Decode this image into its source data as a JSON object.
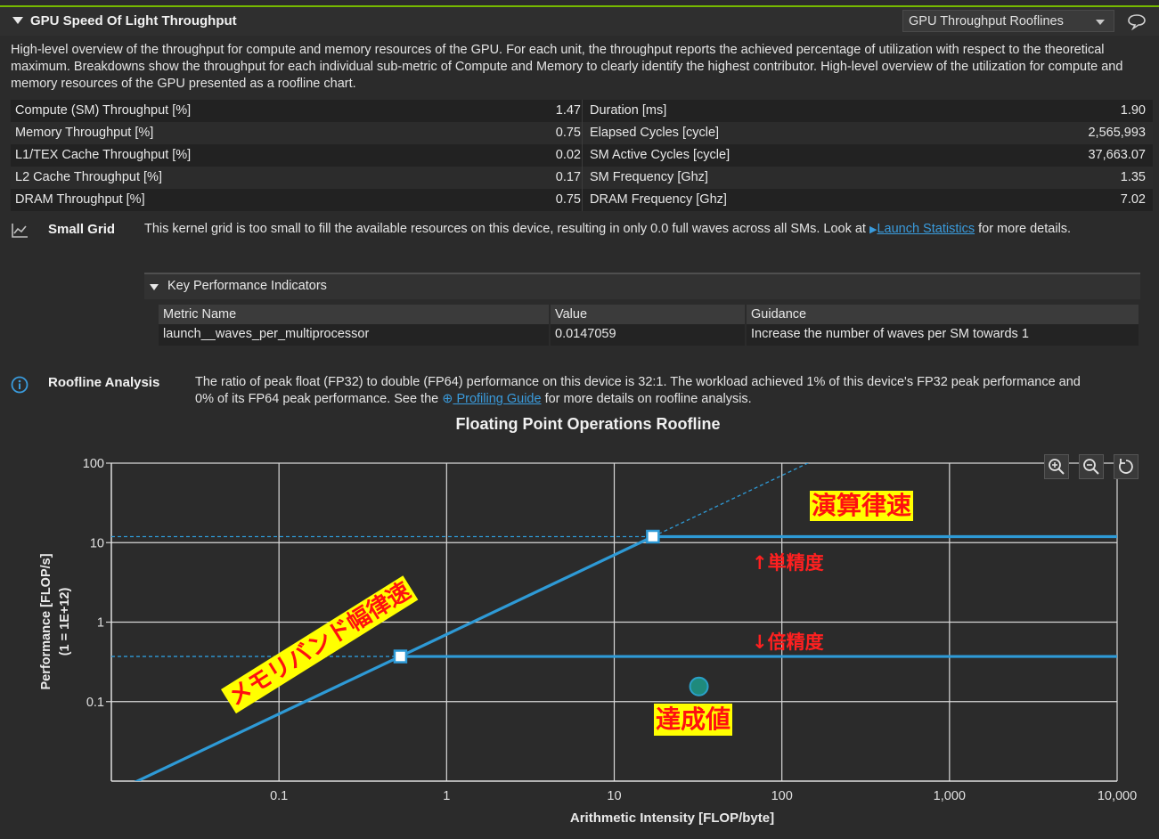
{
  "header": {
    "title": "GPU Speed Of Light Throughput",
    "view_select": "GPU Throughput Rooflines"
  },
  "description": "High-level overview of the throughput for compute and memory resources of the GPU. For each unit, the throughput reports the achieved percentage of utilization with respect to the theoretical maximum. Breakdowns show the throughput for each individual sub-metric of Compute and Memory to clearly identify the highest contributor. High-level overview of the utilization for compute and memory resources of the GPU presented as a roofline chart.",
  "metrics": [
    {
      "left_label": "Compute (SM) Throughput [%]",
      "left_value": "1.47",
      "right_label": "Duration [ms]",
      "right_value": "1.90"
    },
    {
      "left_label": "Memory Throughput [%]",
      "left_value": "0.75",
      "right_label": "Elapsed Cycles [cycle]",
      "right_value": "2,565,993"
    },
    {
      "left_label": "L1/TEX Cache Throughput [%]",
      "left_value": "0.02",
      "right_label": "SM Active Cycles [cycle]",
      "right_value": "37,663.07"
    },
    {
      "left_label": "L2 Cache Throughput [%]",
      "left_value": "0.17",
      "right_label": "SM Frequency [Ghz]",
      "right_value": "1.35"
    },
    {
      "left_label": "DRAM Throughput [%]",
      "left_value": "0.75",
      "right_label": "DRAM Frequency [Ghz]",
      "right_value": "7.02"
    }
  ],
  "small_grid": {
    "title": "Small Grid",
    "text_before": "This kernel grid is too small to fill the available resources on this device, resulting in only 0.0 full waves across all SMs. Look at ",
    "link": "Launch Statistics",
    "text_after": " for more details."
  },
  "kpi": {
    "title": "Key Performance Indicators",
    "headers": [
      "Metric Name",
      "Value",
      "Guidance"
    ],
    "row": [
      "launch__waves_per_multiprocessor",
      "0.0147059",
      "Increase the number of waves per SM towards 1"
    ]
  },
  "roofline": {
    "title": "Roofline Analysis",
    "text_before": "The ratio of peak float (FP32) to double (FP64) performance on this device is 32:1. The workload achieved 1% of this device's FP32 peak performance and 0% of its FP64 peak performance. See the ",
    "link": "Profiling Guide",
    "text_after": " for more details on roofline analysis."
  },
  "annotations": {
    "compute_bound": "演算律速",
    "memory_bound": "メモリバンド幅律速",
    "single_precision": "↑単精度",
    "double_precision": "↓倍精度",
    "achieved": "達成値"
  },
  "colors": {
    "roof": "#2e9ad6",
    "achieved_point": "#1f8a7c",
    "highlight": "#ffff00",
    "annotation_red": "#ff2020",
    "accent_green": "#76b900"
  },
  "chart_data": {
    "type": "line",
    "title": "Floating Point Operations Roofline",
    "xlabel": "Arithmetic Intensity [FLOP/byte]",
    "ylabel": "Performance [FLOP/s]",
    "ylabel2": "(1 = 1E+12)",
    "x_scale": "log",
    "y_scale": "log",
    "xlim": [
      0.01,
      10000
    ],
    "ylim": [
      0.01,
      100
    ],
    "x_ticks": [
      {
        "v": 0.1,
        "label": "0.1"
      },
      {
        "v": 1,
        "label": "1"
      },
      {
        "v": 10,
        "label": "10"
      },
      {
        "v": 100,
        "label": "100"
      },
      {
        "v": 1000,
        "label": "1,000"
      },
      {
        "v": 10000,
        "label": "10,000"
      }
    ],
    "y_ticks": [
      {
        "v": 0.1,
        "label": "0.1"
      },
      {
        "v": 1,
        "label": "1"
      },
      {
        "v": 10,
        "label": "10"
      },
      {
        "v": 100,
        "label": "100"
      }
    ],
    "grid": true,
    "memory_bandwidth_slope": 0.7,
    "series": [
      {
        "ridge_x": 17,
        "peak": 11.9
      },
      {
        "ridge_x": 0.53,
        "peak": 0.37
      }
    ],
    "achieved_point": {
      "x": 32,
      "y": 0.155
    }
  }
}
